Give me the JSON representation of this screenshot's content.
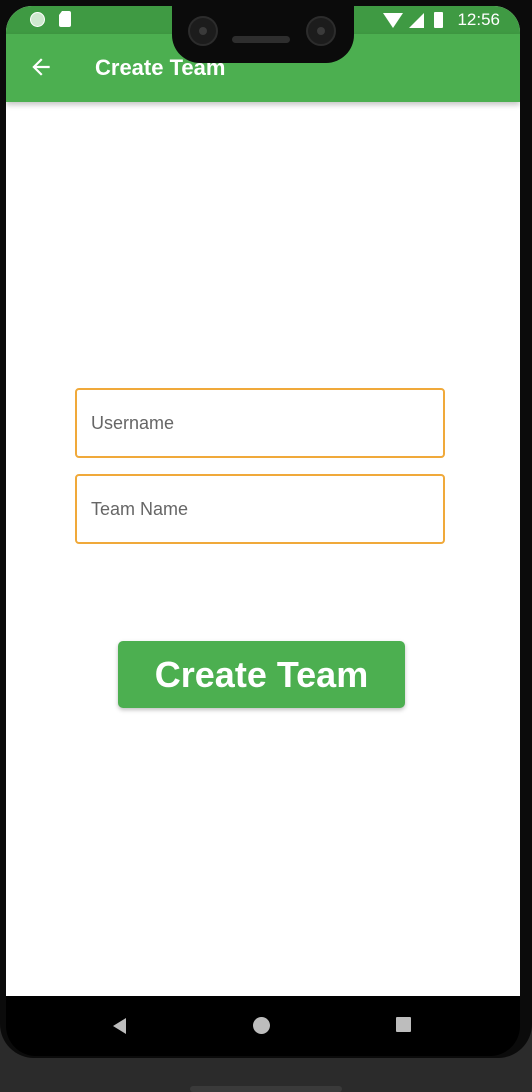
{
  "status_bar": {
    "time": "12:56",
    "icons": [
      "notification-dot-icon",
      "sd-card-icon",
      "wifi-icon",
      "signal-icon",
      "battery-icon"
    ]
  },
  "app_bar": {
    "title": "Create Team",
    "back_icon": "arrow-back-icon"
  },
  "form": {
    "username": {
      "placeholder": "Username",
      "value": ""
    },
    "team_name": {
      "placeholder": "Team Name",
      "value": ""
    },
    "submit_label": "Create Team"
  },
  "nav_bar": {
    "icons": [
      "nav-back-icon",
      "nav-home-icon",
      "nav-recents-icon"
    ]
  },
  "colors": {
    "primary": "#4caf50",
    "status_bar": "#3f9a43",
    "field_border": "#f0a93a",
    "background": "#ffffff"
  }
}
